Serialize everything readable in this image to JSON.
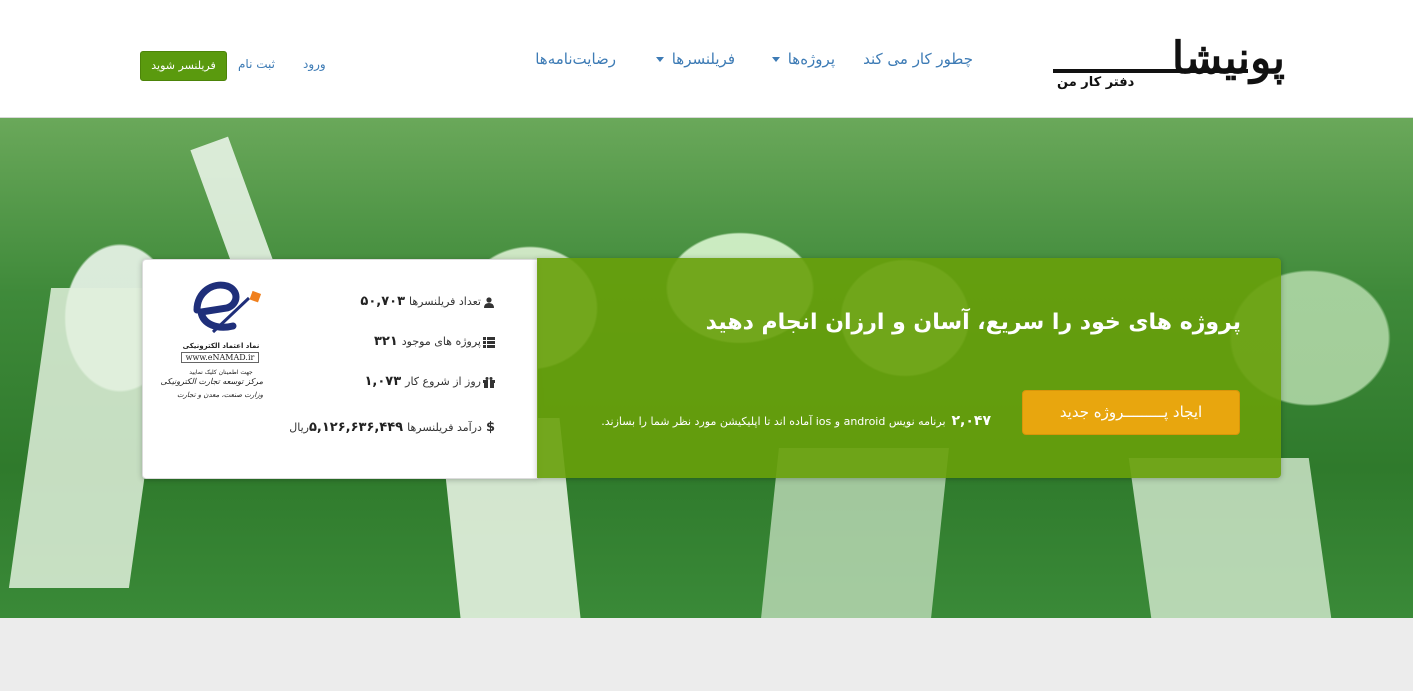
{
  "header": {
    "logo": {
      "main": "پونیشا",
      "sub": "دفتر کار من"
    },
    "nav": [
      {
        "label": "چطور کار می کند"
      },
      {
        "label": "پروژه‌ها"
      },
      {
        "label": "فریلنسرها"
      },
      {
        "label": "رضایت‌نامه‌ها"
      }
    ],
    "login_label": "ورود",
    "register_label": "ثبت نام",
    "freelancer_button": "فریلنسر شوید"
  },
  "stats": {
    "freelancers_label": "تعداد فریلنسرها",
    "freelancers_value": "۵۰,۷۰۳",
    "projects_label": "پروژه های موجود",
    "projects_value": "۳۲۱",
    "days_label": "روز از شروع کار",
    "days_value": "۱,۰۷۳",
    "income_label": "درآمد فریلنسرها",
    "income_value": "۵,۱۲۶,۶۳۶,۴۴۹",
    "income_unit": "ریال",
    "currency_symbol": "$"
  },
  "enamad": {
    "line1": "نماد اعتماد الکترونیکی",
    "site": "www.eNAMAD.ir",
    "line3": "جهت اطمینان کلیک نمایید",
    "line4": "مرکز توسعه تجارت الکترونیکی",
    "line5": "وزارت صنعت، معدن و تجارت"
  },
  "cta": {
    "title": "پروژه های خود را سریع، آسان و ارزان انجام دهید",
    "button": "ایجاد پـــــــــروژه جدید",
    "note_count": "۲,۰۴۷",
    "note_text": "برنامه نویس android و ios آماده اند تا اپلیکیشن مورد نظر شما را بسازند."
  },
  "colors": {
    "link": "#3d7bb5",
    "freelancer_button": "#5a9a0e",
    "cta_panel": "#68a00a",
    "cta_button": "#e8a60e"
  }
}
